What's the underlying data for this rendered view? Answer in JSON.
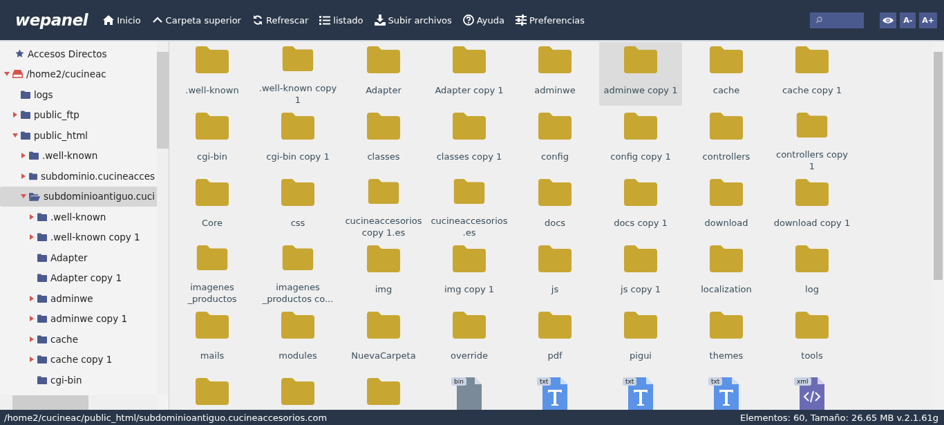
{
  "header": {
    "logo": "wepanel",
    "toolbar": [
      {
        "kind": "home",
        "label": "Inicio"
      },
      {
        "kind": "up",
        "label": "Carpeta superior"
      },
      {
        "kind": "refresh",
        "label": "Refrescar"
      },
      {
        "kind": "list",
        "label": "listado"
      },
      {
        "kind": "upload",
        "label": "Subir archivos"
      },
      {
        "kind": "help",
        "label": "Ayuda"
      },
      {
        "kind": "preferences",
        "label": "Preferencias"
      }
    ],
    "font_buttons": [
      "A-",
      "A+"
    ]
  },
  "sidebar": {
    "shortcuts": "Accesos Directos",
    "tree": [
      {
        "label": "/home2/cucineac",
        "kind": "drive",
        "expanded": true,
        "selected": false,
        "children": [
          {
            "label": "logs",
            "kind": "folder",
            "selected": false
          },
          {
            "label": "public_ftp",
            "kind": "folder",
            "expanded": false,
            "selected": false
          },
          {
            "label": "public_html",
            "kind": "folder",
            "expanded": true,
            "selected": false,
            "children": [
              {
                "label": ".well-known",
                "kind": "folder",
                "expanded": false,
                "selected": false
              },
              {
                "label": "subdominio.cucineacces",
                "kind": "folder",
                "expanded": false,
                "selected": false
              },
              {
                "label": "subdominioantiguo.cuci",
                "kind": "folder",
                "expanded": true,
                "selected": true,
                "children": [
                  {
                    "label": ".well-known",
                    "kind": "folder",
                    "expanded": false,
                    "selected": false
                  },
                  {
                    "label": ".well-known copy 1",
                    "kind": "folder",
                    "expanded": false,
                    "selected": false
                  },
                  {
                    "label": "Adapter",
                    "kind": "folder",
                    "selected": false
                  },
                  {
                    "label": "Adapter copy 1",
                    "kind": "folder",
                    "selected": false
                  },
                  {
                    "label": "adminwe",
                    "kind": "folder",
                    "expanded": false,
                    "selected": false
                  },
                  {
                    "label": "adminwe copy 1",
                    "kind": "folder",
                    "expanded": false,
                    "selected": false
                  },
                  {
                    "label": "cache",
                    "kind": "folder",
                    "expanded": false,
                    "selected": false
                  },
                  {
                    "label": "cache copy 1",
                    "kind": "folder",
                    "expanded": false,
                    "selected": false
                  },
                  {
                    "label": "cgi-bin",
                    "kind": "folder",
                    "selected": false
                  }
                ]
              }
            ]
          }
        ]
      }
    ]
  },
  "files": [
    {
      "kind": "folder",
      "name": ".well-known",
      "selected": false
    },
    {
      "kind": "folder",
      "name": ".well-known copy 1",
      "selected": false
    },
    {
      "kind": "folder",
      "name": "Adapter",
      "selected": false
    },
    {
      "kind": "folder",
      "name": "Adapter copy 1",
      "selected": false
    },
    {
      "kind": "folder",
      "name": "adminwe",
      "selected": false
    },
    {
      "kind": "folder",
      "name": "adminwe copy 1",
      "selected": true
    },
    {
      "kind": "folder",
      "name": "cache",
      "selected": false
    },
    {
      "kind": "folder",
      "name": "cache copy 1",
      "selected": false
    },
    {
      "kind": "folder",
      "name": "cgi-bin",
      "selected": false
    },
    {
      "kind": "folder",
      "name": "cgi-bin copy 1",
      "selected": false
    },
    {
      "kind": "folder",
      "name": "classes",
      "selected": false
    },
    {
      "kind": "folder",
      "name": "classes copy 1",
      "selected": false
    },
    {
      "kind": "folder",
      "name": "config",
      "selected": false
    },
    {
      "kind": "folder",
      "name": "config copy 1",
      "selected": false
    },
    {
      "kind": "folder",
      "name": "controllers",
      "selected": false
    },
    {
      "kind": "folder",
      "name": "controllers copy 1",
      "selected": false
    },
    {
      "kind": "folder",
      "name": "Core",
      "selected": false
    },
    {
      "kind": "folder",
      "name": "css",
      "selected": false
    },
    {
      "kind": "folder",
      "name": "cucineaccesorios copy 1.es",
      "selected": false
    },
    {
      "kind": "folder",
      "name": "cucineaccesorios .es",
      "selected": false
    },
    {
      "kind": "folder",
      "name": "docs",
      "selected": false
    },
    {
      "kind": "folder",
      "name": "docs copy 1",
      "selected": false
    },
    {
      "kind": "folder",
      "name": "download",
      "selected": false
    },
    {
      "kind": "folder",
      "name": "download copy 1",
      "selected": false
    },
    {
      "kind": "folder",
      "name": "imagenes _productos",
      "selected": false
    },
    {
      "kind": "folder",
      "name": "imagenes _productos co...",
      "selected": false
    },
    {
      "kind": "folder",
      "name": "img",
      "selected": false
    },
    {
      "kind": "folder",
      "name": "img copy 1",
      "selected": false
    },
    {
      "kind": "folder",
      "name": "js",
      "selected": false
    },
    {
      "kind": "folder",
      "name": "js copy 1",
      "selected": false
    },
    {
      "kind": "folder",
      "name": "localization",
      "selected": false
    },
    {
      "kind": "folder",
      "name": "log",
      "selected": false
    },
    {
      "kind": "folder",
      "name": "mails",
      "selected": false
    },
    {
      "kind": "folder",
      "name": "modules",
      "selected": false
    },
    {
      "kind": "folder",
      "name": "NuevaCarpeta",
      "selected": false
    },
    {
      "kind": "folder",
      "name": "override",
      "selected": false
    },
    {
      "kind": "folder",
      "name": "pdf",
      "selected": false
    },
    {
      "kind": "folder",
      "name": "pigui",
      "selected": false
    },
    {
      "kind": "folder",
      "name": "themes",
      "selected": false
    },
    {
      "kind": "folder",
      "name": "tools",
      "selected": false
    },
    {
      "kind": "folder",
      "selected": false
    },
    {
      "kind": "folder",
      "selected": false
    },
    {
      "kind": "folder",
      "selected": false
    },
    {
      "kind": "binary-file",
      "ext": "bin",
      "color": "#7a8a99",
      "selected": false
    },
    {
      "kind": "text-file",
      "ext": "txt",
      "color": "#5b93e8",
      "selected": false
    },
    {
      "kind": "text-file",
      "ext": "txt",
      "color": "#5b93e8",
      "selected": false
    },
    {
      "kind": "text-file",
      "ext": "txt",
      "color": "#5b93e8",
      "selected": false
    },
    {
      "kind": "code-file",
      "ext": "xml",
      "color": "#6b6bb5",
      "selected": false
    }
  ],
  "status_bar": {
    "path": "/home2/cucineac/public_html/subdominioantiguo.cucineaccesorios.com",
    "info": "Elementos: 60, Tamaño: 26.65 MB v.2.1.61g"
  }
}
